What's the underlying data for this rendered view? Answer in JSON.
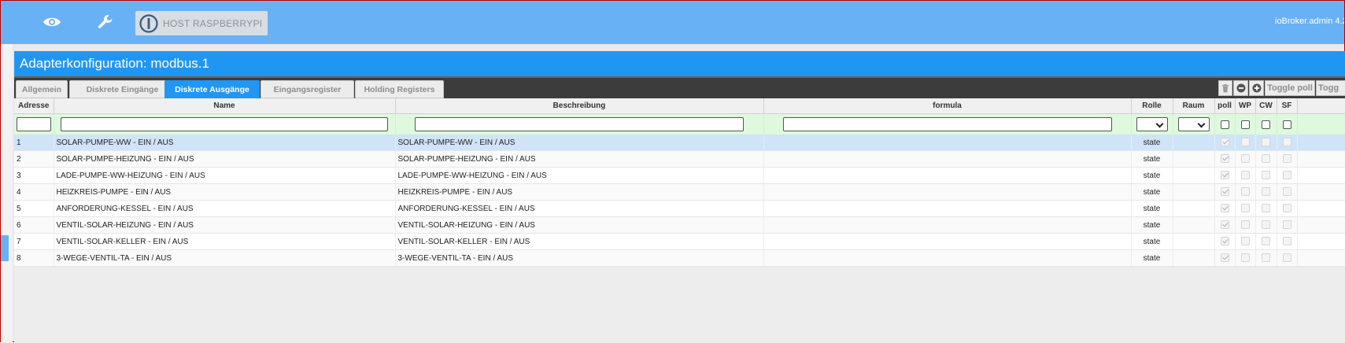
{
  "topbar": {
    "icons": [
      "eye-icon",
      "wrench-icon"
    ],
    "host_label": "HOST RASPBERRYPI",
    "admin_version": "ioBroker.admin 4.2"
  },
  "panel": {
    "title": "Adapterkonfiguration: modbus.1"
  },
  "tabs": [
    {
      "label": "Allgemein",
      "active": false
    },
    {
      "label": "Diskrete Eingänge",
      "active": false
    },
    {
      "label": "Diskrete Ausgänge",
      "active": true
    },
    {
      "label": "Eingangsregister",
      "active": false
    },
    {
      "label": "Holding Registers",
      "active": false
    }
  ],
  "toolbar": {
    "toggle_poll": "Toggle poll",
    "toggle_cut": "Togg"
  },
  "table": {
    "columns": [
      "Adresse",
      "Name",
      "Beschreibung",
      "formula",
      "Rolle",
      "Raum",
      "poll",
      "WP",
      "CW",
      "SF"
    ],
    "rows": [
      {
        "address": "1",
        "name": "SOLAR-PUMPE-WW - EIN / AUS",
        "description": "SOLAR-PUMPE-WW - EIN / AUS",
        "role": "state",
        "poll": true
      },
      {
        "address": "2",
        "name": "SOLAR-PUMPE-HEIZUNG - EIN / AUS",
        "description": "SOLAR-PUMPE-HEIZUNG - EIN / AUS",
        "role": "state",
        "poll": true
      },
      {
        "address": "3",
        "name": "LADE-PUMPE-WW-HEIZUNG - EIN / AUS",
        "description": "LADE-PUMPE-WW-HEIZUNG - EIN / AUS",
        "role": "state",
        "poll": true
      },
      {
        "address": "4",
        "name": "HEIZKREIS-PUMPE - EIN / AUS",
        "description": "HEIZKREIS-PUMPE - EIN / AUS",
        "role": "state",
        "poll": true
      },
      {
        "address": "5",
        "name": "ANFORDERUNG-KESSEL - EIN / AUS",
        "description": "ANFORDERUNG-KESSEL - EIN / AUS",
        "role": "state",
        "poll": true
      },
      {
        "address": "6",
        "name": "VENTIL-SOLAR-HEIZUNG - EIN / AUS",
        "description": "VENTIL-SOLAR-HEIZUNG - EIN / AUS",
        "role": "state",
        "poll": true
      },
      {
        "address": "7",
        "name": "VENTIL-SOLAR-KELLER - EIN / AUS",
        "description": "VENTIL-SOLAR-KELLER - EIN / AUS",
        "role": "state",
        "poll": true
      },
      {
        "address": "8",
        "name": "3-WEGE-VENTIL-TA - EIN / AUS",
        "description": "3-WEGE-VENTIL-TA - EIN / AUS",
        "role": "state",
        "poll": true
      }
    ]
  },
  "colors": {
    "topbar": "#68b1f4",
    "title_bar": "#2096f3",
    "active_tab": "#2196f3",
    "filter_row": "#def9de",
    "selected_row": "#cfe4f7"
  }
}
